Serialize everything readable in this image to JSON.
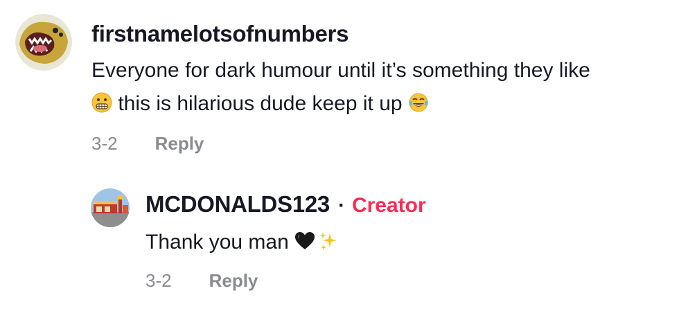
{
  "comment": {
    "username": "firstnamelotsofnumbers",
    "text_line1": "Everyone for dark humour until it’s something they like",
    "text_line2": "this is hilarious dude keep it up",
    "date": "3-2",
    "reply_label": "Reply",
    "icons": [
      "grimacing-face-emoji",
      "tears-of-joy-emoji"
    ]
  },
  "reply": {
    "username": "MCDONALDS123",
    "separator": "·",
    "badge": "Creator",
    "text": "Thank you man",
    "date": "3-2",
    "reply_label": "Reply",
    "icons": [
      "black-heart-emoji",
      "sparkles-emoji"
    ]
  },
  "colors": {
    "text": "#161823",
    "muted": "#8a8b91",
    "creator_badge": "#fe2c55"
  }
}
